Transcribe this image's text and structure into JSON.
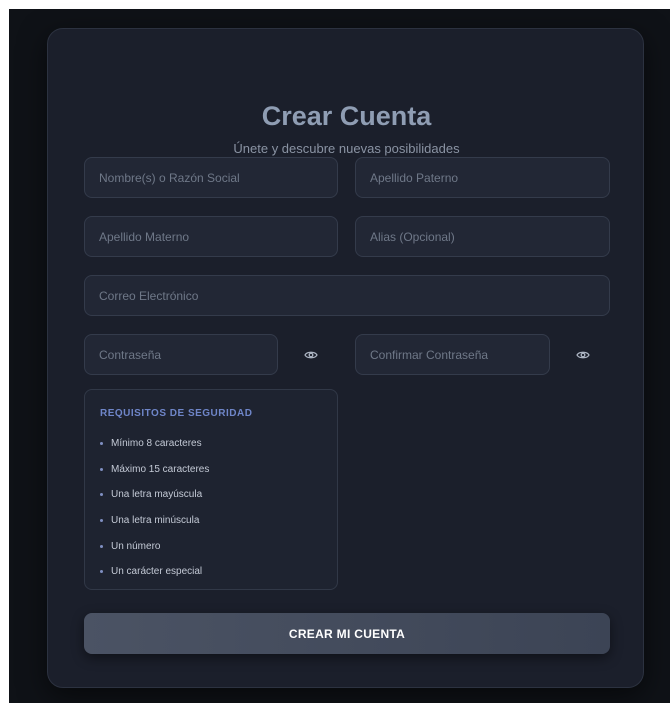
{
  "header": {
    "title": "Crear Cuenta",
    "subtitle": "Únete y descubre nuevas posibilidades"
  },
  "form": {
    "first_name": {
      "placeholder": "Nombre(s) o Razón Social",
      "value": ""
    },
    "paternal_surname": {
      "placeholder": "Apellido Paterno",
      "value": ""
    },
    "maternal_surname": {
      "placeholder": "Apellido Materno",
      "value": ""
    },
    "alias": {
      "placeholder": "Alias (Opcional)",
      "value": ""
    },
    "email": {
      "placeholder": "Correo Electrónico",
      "value": ""
    },
    "password": {
      "placeholder": "Contraseña",
      "value": ""
    },
    "confirm_password": {
      "placeholder": "Confirmar Contraseña",
      "value": ""
    }
  },
  "requirements": {
    "title": "REQUISITOS DE SEGURIDAD",
    "items": [
      "Mínimo 8 caracteres",
      "Máximo 15 caracteres",
      "Una letra mayúscula",
      "Una letra minúscula",
      "Un número",
      "Un carácter especial"
    ]
  },
  "submit": {
    "label": "CREAR MI CUENTA"
  },
  "icons": {
    "password_toggle": "eye-icon",
    "confirm_password_toggle": "eye-icon"
  },
  "colors": {
    "background": "#0f1217",
    "card": "#1b1f2b",
    "title": "#8f9db3",
    "accent": "#6f86c9"
  }
}
